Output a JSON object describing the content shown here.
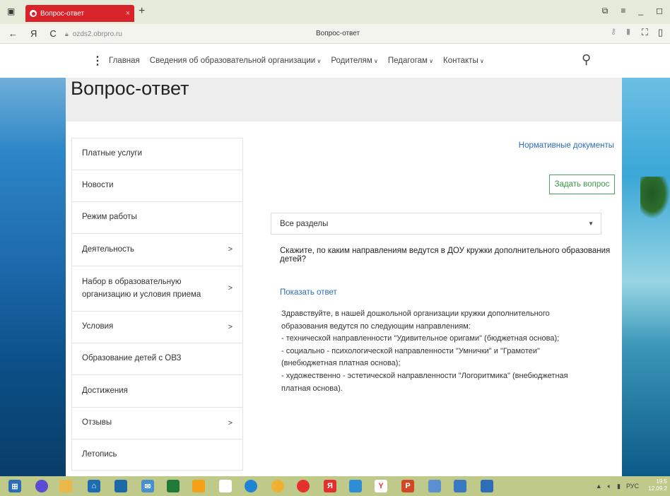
{
  "browser": {
    "tab_title": "Вопрос-ответ",
    "tab_close": "×",
    "new_tab": "+",
    "url": "ozds2.obrpro.ru",
    "page_title": "Вопрос-ответ",
    "back": "←",
    "yandex": "Я",
    "reload": "C",
    "controls": [
      "◻",
      "≡",
      "_",
      "◻"
    ]
  },
  "site_nav": {
    "items": [
      {
        "label": "Главная",
        "has_dropdown": false
      },
      {
        "label": "Сведения об образовательной организации",
        "has_dropdown": true
      },
      {
        "label": "Родителям",
        "has_dropdown": true
      },
      {
        "label": "Педагогам",
        "has_dropdown": true
      },
      {
        "label": "Контакты",
        "has_dropdown": true
      }
    ]
  },
  "page": {
    "title": "Вопрос-ответ"
  },
  "sidebar": {
    "items": [
      {
        "label": "Платные услуги",
        "has_arrow": false
      },
      {
        "label": "Новости",
        "has_arrow": false
      },
      {
        "label": "Режим работы",
        "has_arrow": false
      },
      {
        "label": "Деятельность",
        "has_arrow": true
      },
      {
        "label": "Набор в образовательную организацию и условия приема",
        "has_arrow": true
      },
      {
        "label": "Условия",
        "has_arrow": true
      },
      {
        "label": "Образование детей с ОВЗ",
        "has_arrow": false
      },
      {
        "label": "Достижения",
        "has_arrow": false
      },
      {
        "label": "Отзывы",
        "has_arrow": true
      },
      {
        "label": "Летопись",
        "has_arrow": false
      }
    ]
  },
  "content": {
    "norm_docs_link": "Нормативные документы",
    "ask_button": "Задать вопрос",
    "section_select": "Все разделы",
    "question": "Скажите, по каким направлениям ведутся в ДОУ кружки дополнительного образования детей?",
    "show_answer": "Показать ответ",
    "answer_lines": [
      "Здравствуйте, в нашей дошкольной организации кружки дополнительного образования ведутся по следующим направлениям:",
      "- технической направленности \"Удивительное оригами\" (бюджетная основа);",
      "- социально - психологической направленности \"Умнички\" и \"Грамотеи\" (внебюджетная платная основа);",
      "- художественно - эстетической направленности \"Логоритмика\" (внебюджетная платная основа)."
    ]
  },
  "taskbar": {
    "tray_lang": "РУС",
    "clock_time": "19:5",
    "clock_date": "12.09.2"
  },
  "colors": {
    "tab_red": "#d9232a",
    "link_blue": "#2a6ebb",
    "button_green": "#3a9a4e",
    "taskbar": "#bfc98a"
  }
}
